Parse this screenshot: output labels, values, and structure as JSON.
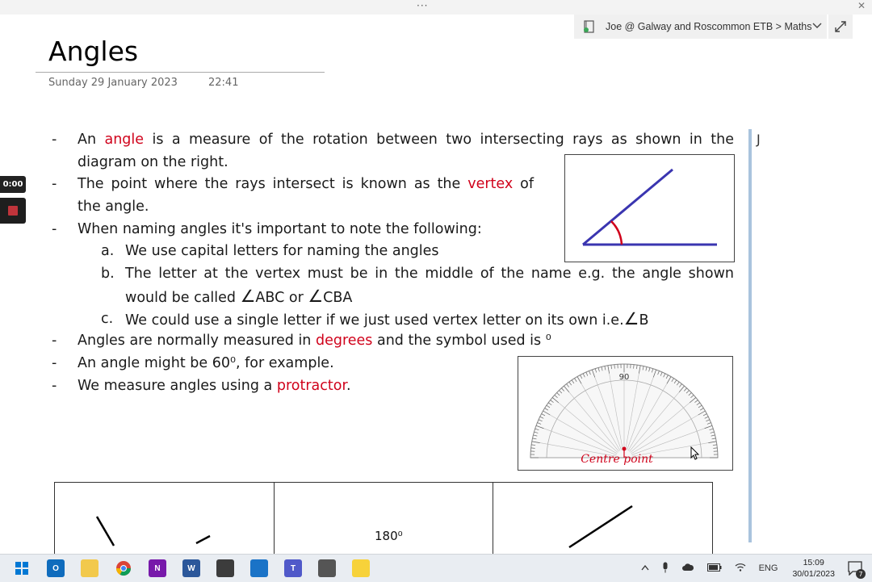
{
  "window": {
    "menu_dots": "···",
    "close": "✕"
  },
  "breadcrumb": {
    "text": "Joe @ Galway and Roscommon ETB > Maths"
  },
  "page": {
    "title": "Angles",
    "date": "Sunday 29 January 2023",
    "time": "22:41"
  },
  "recorder": {
    "time": "0:00"
  },
  "notes": {
    "l1a": "An ",
    "l1b": "angle",
    "l1c": " is a measure of the rotation between two intersecting rays as shown in the",
    "l2": "diagram on the right.",
    "l3a": "The point where the rays intersect is known as the ",
    "l3b": "vertex",
    "l3c": " of",
    "l4": "the angle.",
    "l5": "When naming angles it's important to note the following:",
    "a_letter": "a.",
    "a_text": "We use capital letters for naming the angles",
    "b_letter": "b.",
    "b_text": "The letter at the vertex must be in the middle of the name e.g. the angle shown",
    "b2a": "would be called ",
    "b2b": "∠",
    "b2c": "ABC or ",
    "b2d": "∠",
    "b2e": "CBA",
    "c_letter": "c.",
    "c_text": "We could use a single letter if we just used vertex letter on its own i.e.",
    "c_sym": "∠",
    "c_b": "B",
    "l6a": "Angles are normally measured in ",
    "l6b": "degrees",
    "l6c": " and the symbol used is ",
    "l6d": "⁰",
    "l7": "An angle might be 60⁰, for example.",
    "l8a": "We measure angles using a ",
    "l8b": "protractor",
    "l8c": "."
  },
  "figures": {
    "protractor_top": "90",
    "centre_point": "Centre point"
  },
  "side": {
    "letter": "J"
  },
  "table": {
    "middle": "180⁰"
  },
  "taskbar": {
    "lang": "ENG",
    "time": "15:09",
    "date": "30/01/2023",
    "notifications": "7",
    "apps": [
      {
        "name": "windows-start",
        "label": "",
        "color": "#0078d4"
      },
      {
        "name": "outlook",
        "label": "O",
        "color": "#0f6cbd"
      },
      {
        "name": "file-explorer",
        "label": "",
        "color": "#f2c94c"
      },
      {
        "name": "chrome",
        "label": "",
        "color": "#34a853"
      },
      {
        "name": "onenote",
        "label": "N",
        "color": "#7719aa"
      },
      {
        "name": "word",
        "label": "W",
        "color": "#2b579a"
      },
      {
        "name": "calculator",
        "label": "",
        "color": "#3c3c3c"
      },
      {
        "name": "edge",
        "label": "",
        "color": "#1a73c7"
      },
      {
        "name": "teams",
        "label": "T",
        "color": "#5059c9"
      },
      {
        "name": "phone",
        "label": "",
        "color": "#555555"
      },
      {
        "name": "sticky-notes",
        "label": "",
        "color": "#f7d23a"
      }
    ]
  }
}
